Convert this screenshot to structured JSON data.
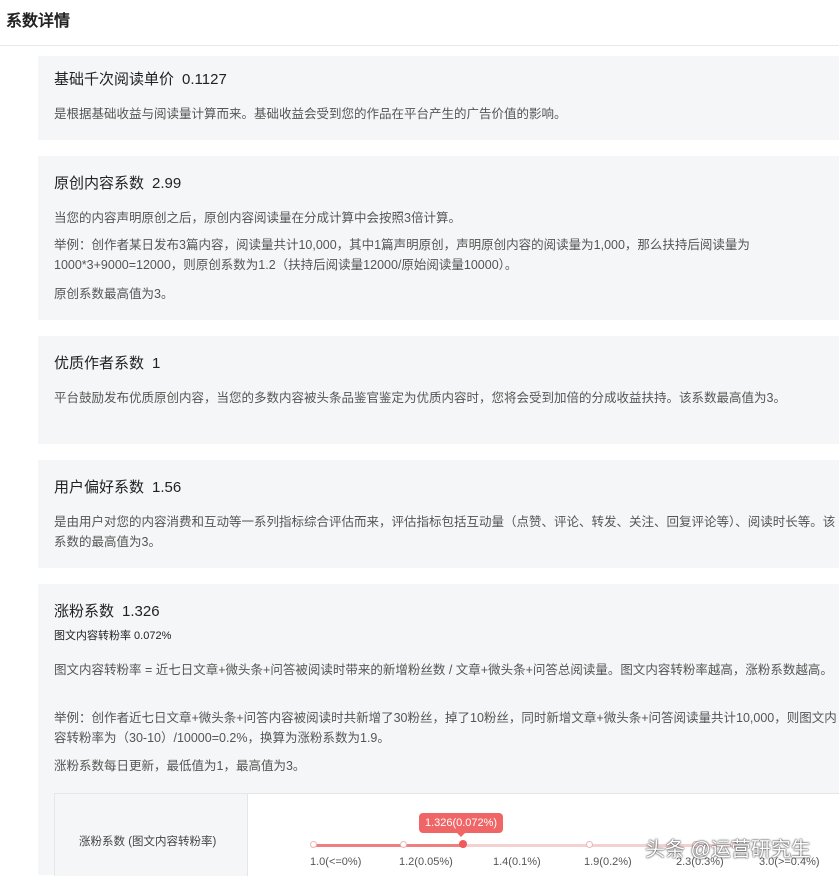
{
  "header": {
    "title": "系数详情"
  },
  "cards": [
    {
      "title": "基础千次阅读单价",
      "value": "0.1127",
      "paragraphs": [
        "是根据基础收益与阅读量计算而来。基础收益会受到您的作品在平台产生的广告价值的影响。"
      ]
    },
    {
      "title": "原创内容系数",
      "value": "2.99",
      "paragraphs": [
        "当您的内容声明原创之后，原创内容阅读量在分成计算中会按照3倍计算。",
        "举例：创作者某日发布3篇内容，阅读量共计10,000，其中1篇声明原创，声明原创内容的阅读量为1,000，那么扶持后阅读量为1000*3+9000=12000，则原创系数为1.2（扶持后阅读量12000/原始阅读量10000）。",
        "原创系数最高值为3。"
      ]
    },
    {
      "title": "优质作者系数",
      "value": "1",
      "paragraphs": [
        "平台鼓励发布优质原创内容，当您的多数内容被头条品鉴官鉴定为优质内容时，您将会受到加倍的分成收益扶持。该系数最高值为3。"
      ]
    },
    {
      "title": "用户偏好系数",
      "value": "1.56",
      "paragraphs": [
        "是由用户对您的内容消费和互动等一系列指标综合评估而来，评估指标包括互动量（点赞、评论、转发、关注、回复评论等）、阅读时长等。该系数的最高值为3。"
      ]
    },
    {
      "title": "涨粉系数",
      "value": "1.326",
      "subtitle": "图文内容转粉率 0.072%",
      "paragraphs": [
        "图文内容转粉率 = 近七日文章+微头条+问答被阅读时带来的新增粉丝数 / 文章+微头条+问答总阅读量。图文内容转粉率越高，涨粉系数越高。",
        "举例：创作者近七日文章+微头条+问答内容被阅读时共新增了30粉丝，掉了10粉丝，同时新增文章+微头条+问答阅读量共计10,000，则图文内容转粉率为（30-10）/10000=0.2%，换算为涨粉系数为1.9。",
        "涨粉系数每日更新，最低值为1，最高值为3。"
      ]
    }
  ],
  "fans_scale": {
    "label": "涨粉系数 (图文内容转粉率)",
    "current_label": "1.326(0.072%)",
    "current_position": 0.357,
    "ticks": [
      "1.0(<=0%)",
      "1.2(0.05%)",
      "1.4(0.1%)",
      "1.9(0.2%)",
      "2.3(0.3%)",
      "3.0(>=0.4%)"
    ],
    "colors": {
      "accent": "#f06666",
      "track": "#f3d1d1"
    }
  },
  "watermark": "头条 @运营研究生"
}
